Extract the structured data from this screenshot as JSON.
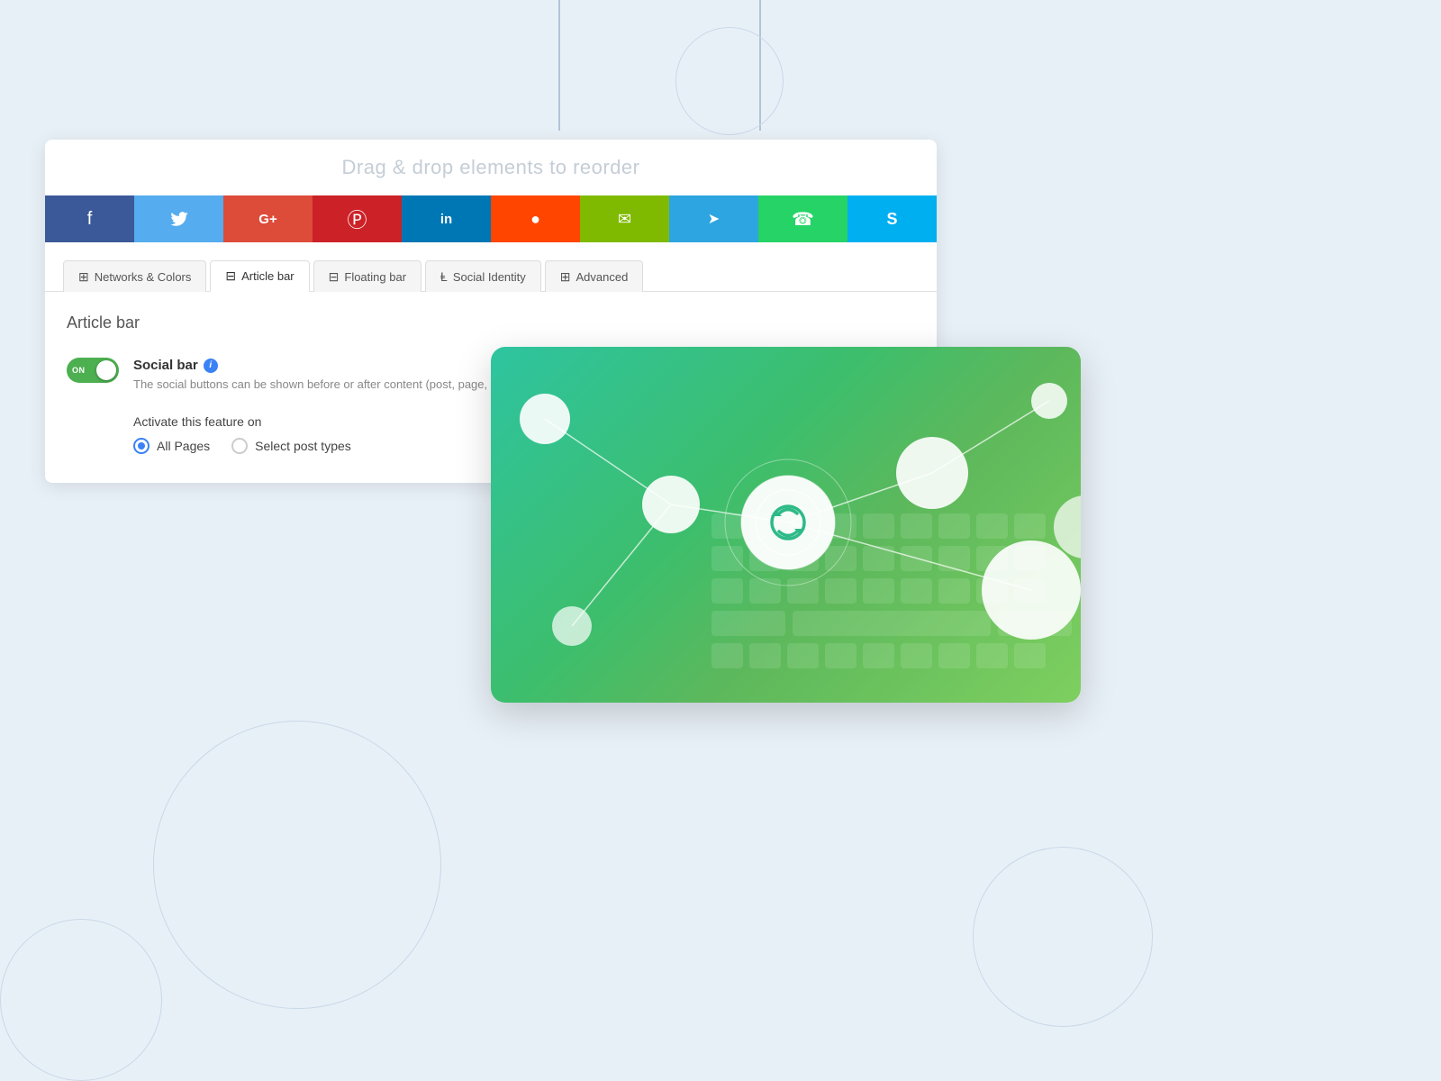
{
  "background": {
    "color": "#e8f0f7"
  },
  "drag_banner": {
    "text": "Drag & drop elements to reorder"
  },
  "social_networks": [
    {
      "name": "facebook",
      "color": "#3b5998",
      "symbol": "f"
    },
    {
      "name": "twitter",
      "color": "#55acee",
      "symbol": "t"
    },
    {
      "name": "google-plus",
      "color": "#dd4b39",
      "symbol": "G+"
    },
    {
      "name": "pinterest",
      "color": "#cc2127",
      "symbol": "p"
    },
    {
      "name": "linkedin",
      "color": "#0077b5",
      "symbol": "in"
    },
    {
      "name": "reddit",
      "color": "#ff4500",
      "symbol": "r"
    },
    {
      "name": "email",
      "color": "#7fba00",
      "symbol": "✉"
    },
    {
      "name": "telegram",
      "color": "#2ca5e0",
      "symbol": "➤"
    },
    {
      "name": "whatsapp",
      "color": "#25d366",
      "symbol": "w"
    },
    {
      "name": "skype",
      "color": "#00aff0",
      "symbol": "S"
    }
  ],
  "tabs": [
    {
      "id": "networks-colors",
      "label": "Networks & Colors",
      "icon": "grid",
      "active": false
    },
    {
      "id": "article-bar",
      "label": "Article bar",
      "icon": "grid",
      "active": true
    },
    {
      "id": "floating-bar",
      "label": "Floating bar",
      "icon": "grid",
      "active": false
    },
    {
      "id": "social-identity",
      "label": "Social Identity",
      "icon": "share",
      "active": false
    },
    {
      "id": "advanced",
      "label": "Advanced",
      "icon": "grid",
      "active": false
    }
  ],
  "content": {
    "section_title": "Article bar",
    "social_bar_setting": {
      "name": "Social bar",
      "description": "The social buttons can be shown before or after content (post, page, custo...",
      "toggle_on": true,
      "toggle_label": "ON"
    },
    "activate_feature": {
      "label": "Activate this feature on",
      "options": [
        {
          "id": "all-pages",
          "label": "All Pages",
          "selected": true
        },
        {
          "id": "select-post-types",
          "label": "Select post types",
          "selected": false
        }
      ]
    }
  }
}
